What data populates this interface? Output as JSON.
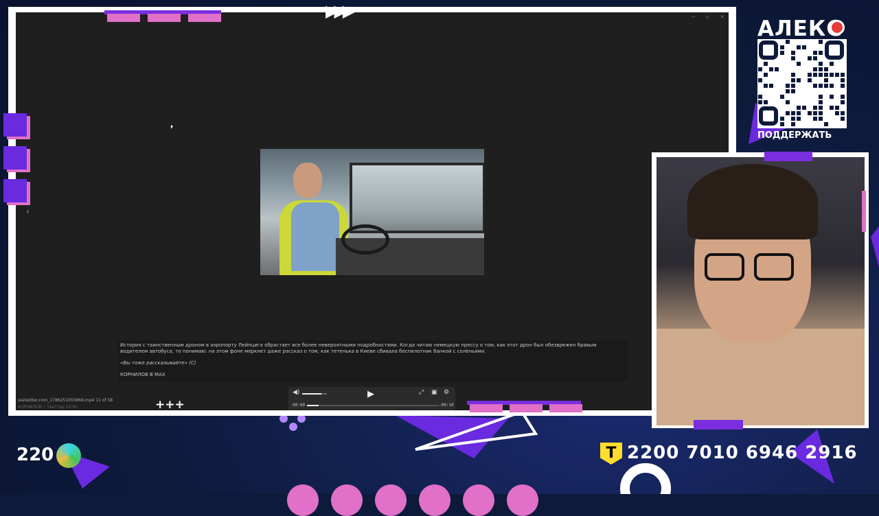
{
  "viewer": {
    "caption": "История с таинственным дроном в аэропорту Лейпцига обрастает все более невероятными подробностями. Когда читаю немецкую прессу о том, как этот дрон был обезврежен бравым водителем автобуса, то понимаю: на этом фоне меркнет даже рассказ о том, как тетенька в Киеве сбивала беспилотник банкой с соленьями.",
    "quote": "«Вы тоже рассказывайте» (С)",
    "author": "КОРНИЛОВ В MAX",
    "file_name": "ssstwitter.com_1786251055869.mp4 11 of 58",
    "file_info2": "КОРНИЛОВ • Твиттер 10:00",
    "time_current": "00:00",
    "time_remaining": "-00:10",
    "volume_level": 0.78,
    "progress": 0.09
  },
  "window_controls": {
    "minimize": "–",
    "restore": "▫",
    "close": "×"
  },
  "overlay": {
    "streamer_name": "АЛЕКС",
    "support_label": "ПОДДЕРЖАТЬ",
    "bottom_left_number": "220",
    "card_number": "2200 7010 6946 2916",
    "t_badge": "T"
  },
  "colors": {
    "accent_pink": "#e070c8",
    "accent_purple": "#7a2ee0",
    "background": "#0d1a3a"
  }
}
